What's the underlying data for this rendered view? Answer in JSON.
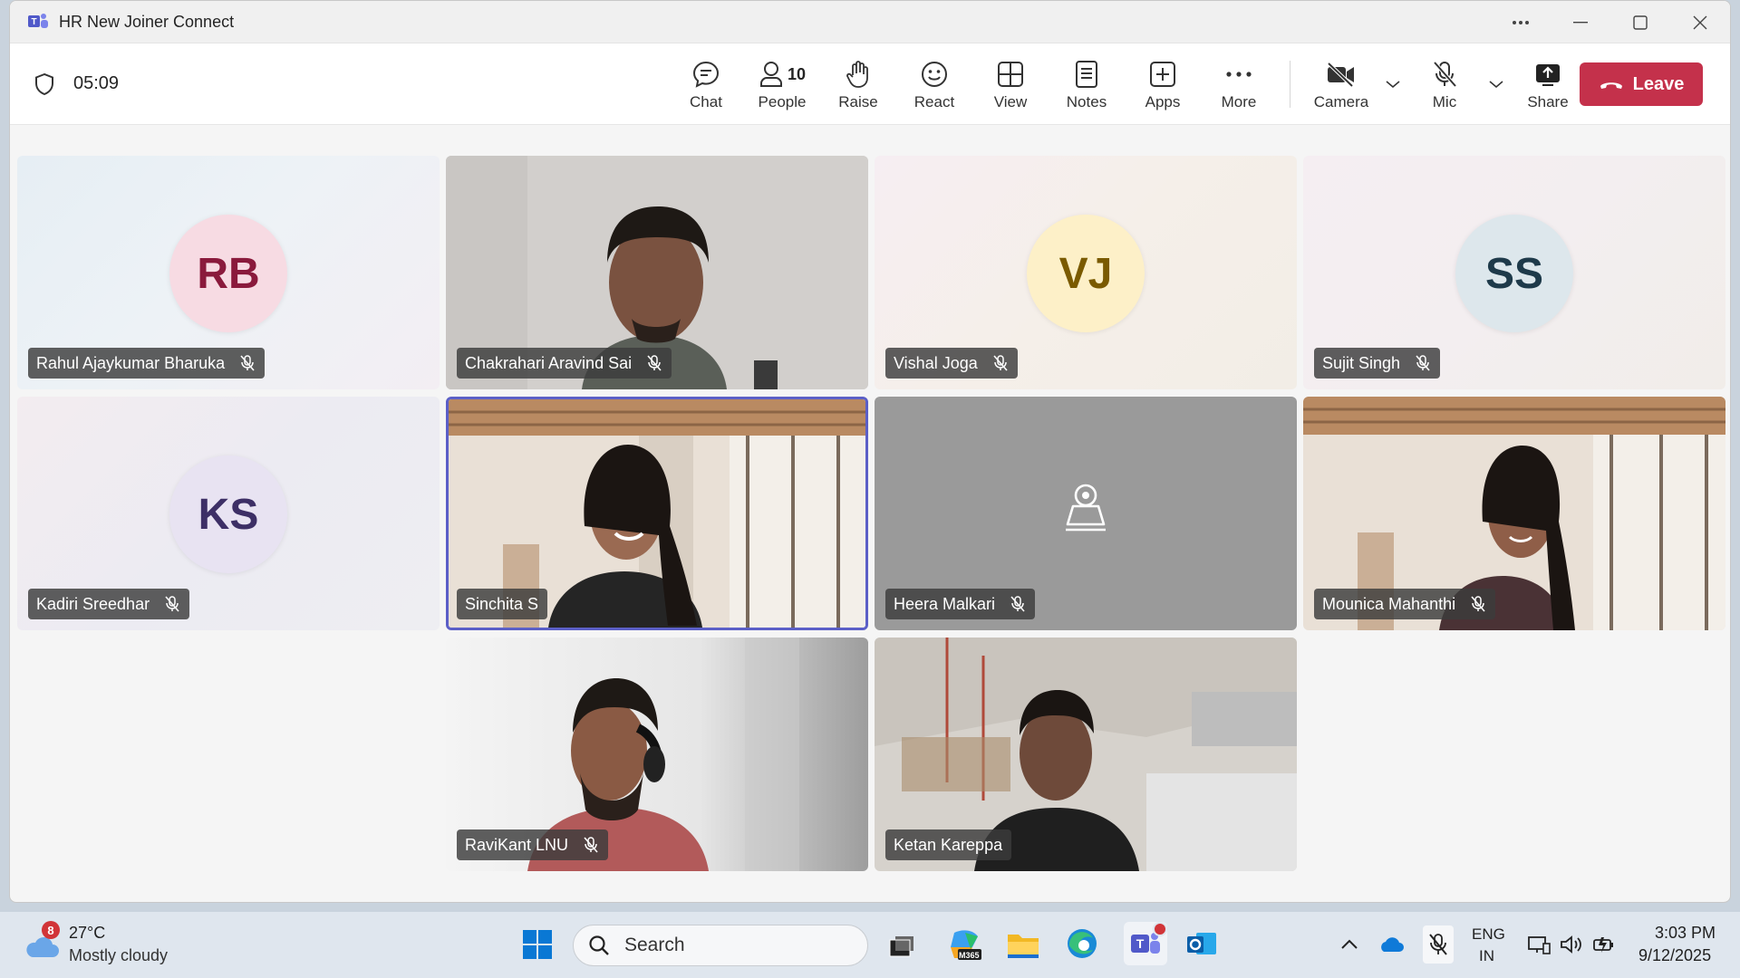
{
  "window": {
    "title": "HR New Joiner Connect"
  },
  "meeting": {
    "timer": "05:09",
    "people_count": "10"
  },
  "toolbar": {
    "chat": "Chat",
    "people": "People",
    "raise": "Raise",
    "react": "React",
    "view": "View",
    "notes": "Notes",
    "apps": "Apps",
    "more": "More",
    "camera": "Camera",
    "mic": "Mic",
    "share": "Share",
    "leave": "Leave"
  },
  "participants": [
    {
      "name": "Rahul Ajaykumar Bharuka",
      "initials": "RB",
      "type": "avatar",
      "muted": true,
      "avatar_color": "#f7dbe3",
      "initials_color": "#8a1a3c"
    },
    {
      "name": "Chakrahari Aravind Sai",
      "type": "video",
      "muted": true
    },
    {
      "name": "Vishal Joga",
      "initials": "VJ",
      "type": "avatar",
      "muted": true,
      "avatar_color": "#fdf0c8",
      "initials_color": "#7a5a00"
    },
    {
      "name": "Sujit Singh",
      "initials": "SS",
      "type": "avatar",
      "muted": true,
      "avatar_color": "#dde7ec",
      "initials_color": "#1e3a4a"
    },
    {
      "name": "Kadiri Sreedhar",
      "initials": "KS",
      "type": "avatar",
      "muted": true,
      "avatar_color": "#e8e3f2",
      "initials_color": "#3d2f66"
    },
    {
      "name": "Sinchita S",
      "type": "video",
      "muted": false,
      "speaking": true
    },
    {
      "name": "Heera Malkari",
      "type": "camera-off",
      "muted": true
    },
    {
      "name": "Mounica Mahanthi",
      "type": "video",
      "muted": true
    },
    {
      "name": "RaviKant LNU",
      "type": "video",
      "muted": true
    },
    {
      "name": "Ketan Kareppa",
      "type": "video",
      "muted": false
    }
  ],
  "taskbar": {
    "weather_temp": "27°C",
    "weather_desc": "Mostly cloudy",
    "weather_badge": "8",
    "search_placeholder": "Search",
    "lang_top": "ENG",
    "lang_bottom": "IN",
    "time": "3:03 PM",
    "date": "9/12/2025",
    "m365_label": "M365"
  },
  "colors": {
    "accent": "#5b5fc7",
    "leave": "#c4314b"
  }
}
